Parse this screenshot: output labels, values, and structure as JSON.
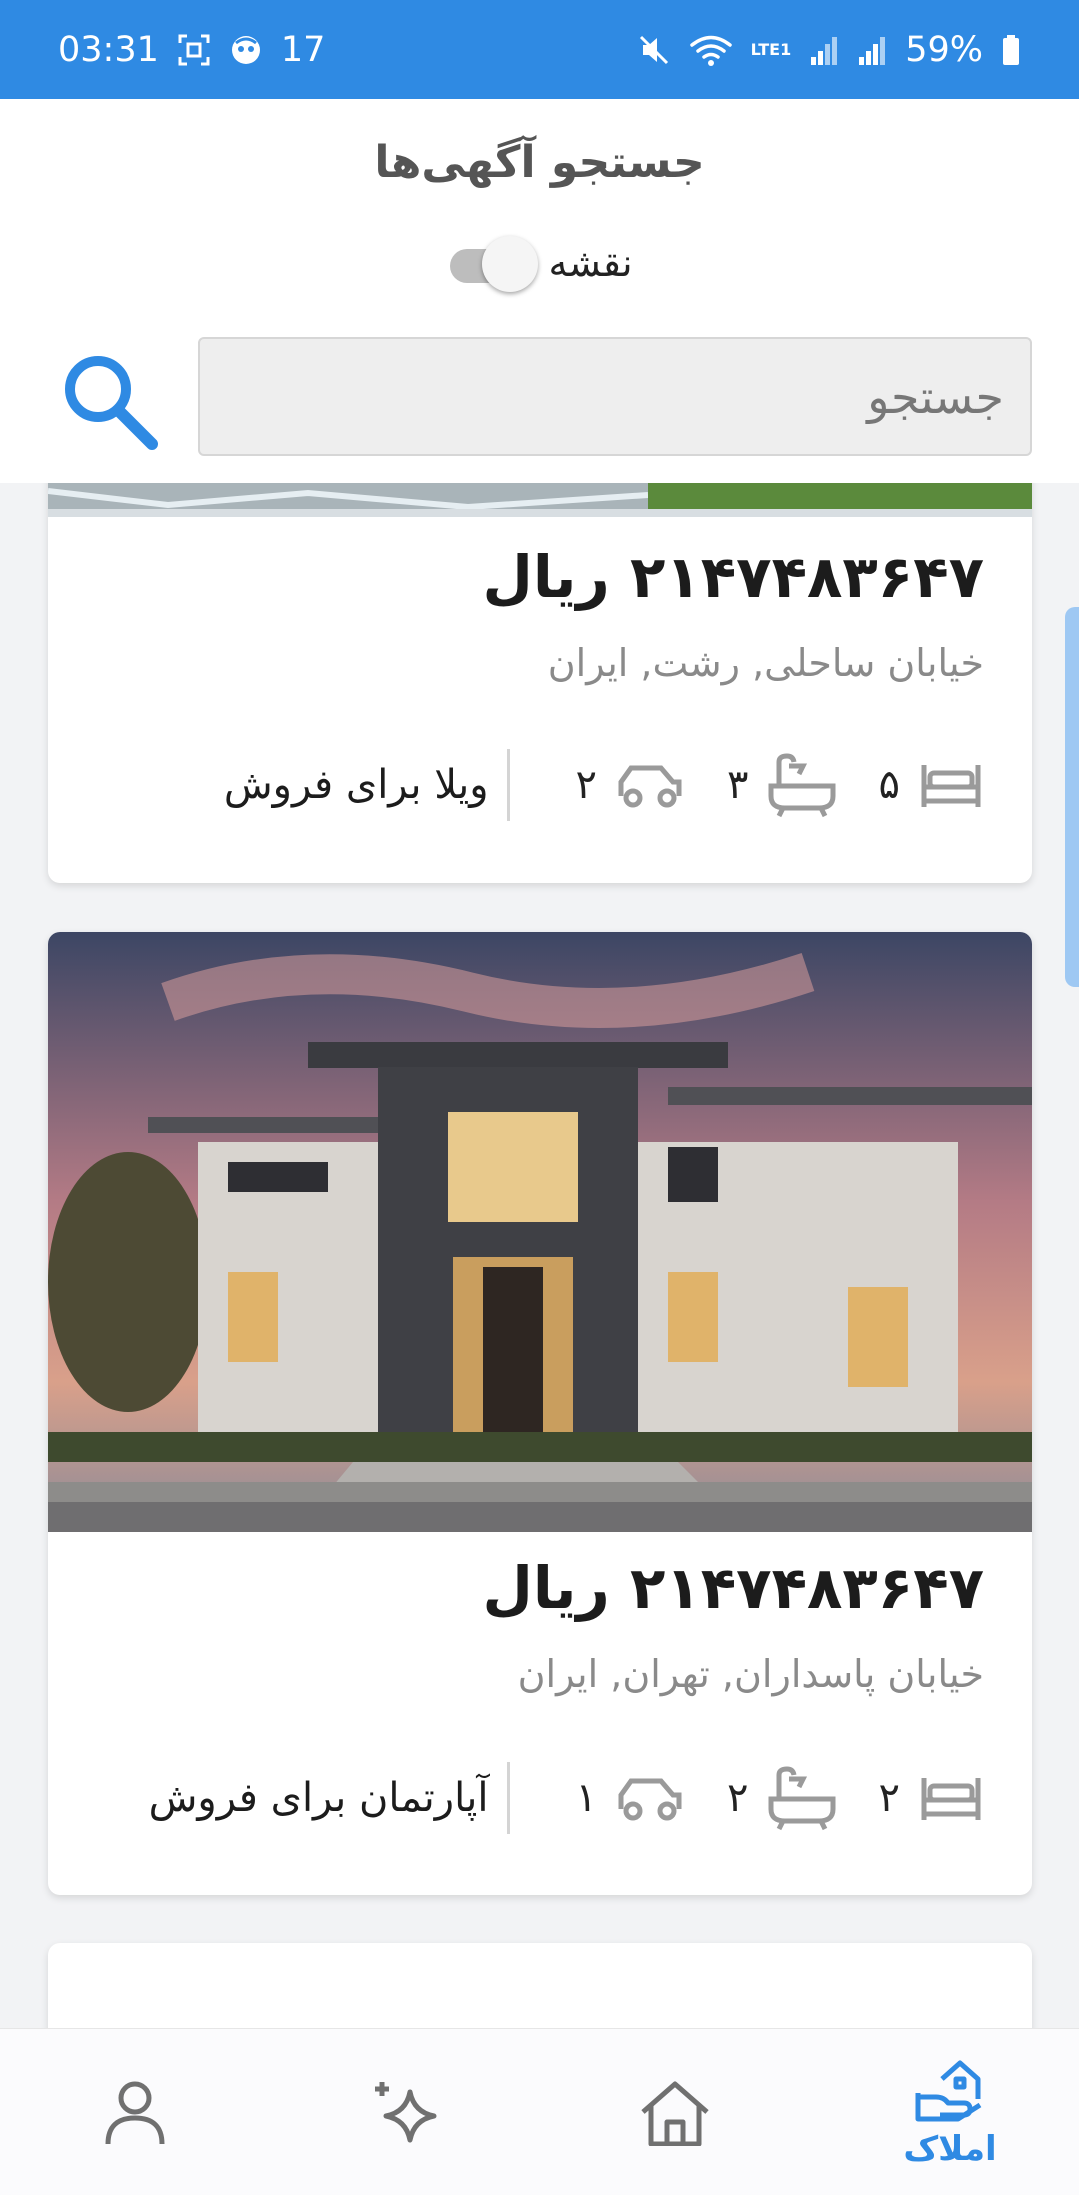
{
  "status_bar": {
    "time": "03:31",
    "notification_count": "17",
    "battery": "59%",
    "network": "LTE1"
  },
  "header": {
    "title": "جستجو آگهی‌ها",
    "map_toggle_label": "نقشه",
    "map_toggle_on": false
  },
  "search": {
    "placeholder": "جستجو"
  },
  "listings": [
    {
      "price": "۲۱۴۷۴۸۳۶۴۷ ریال",
      "address": "خیابان ساحلی, رشت, ایران",
      "beds": "۵",
      "baths": "۳",
      "parking": "۲",
      "type": "ویلا برای فروش"
    },
    {
      "price": "۲۱۴۷۴۸۳۶۴۷ ریال",
      "address": "خیابان پاسداران, تهران, ایران",
      "beds": "۲",
      "baths": "۲",
      "parking": "۱",
      "type": "آپارتمان برای فروش"
    }
  ],
  "bottom_nav": {
    "items": [
      {
        "icon": "profile-icon",
        "label": ""
      },
      {
        "icon": "sparkle-icon",
        "label": ""
      },
      {
        "icon": "home-icon",
        "label": ""
      },
      {
        "icon": "properties-icon",
        "label": "املاک",
        "active": true
      }
    ]
  },
  "colors": {
    "accent": "#2f8ae3",
    "status_bar": "#2f8ae3",
    "price_text": "#1c1c1c",
    "address_text": "#8a8a8a"
  }
}
